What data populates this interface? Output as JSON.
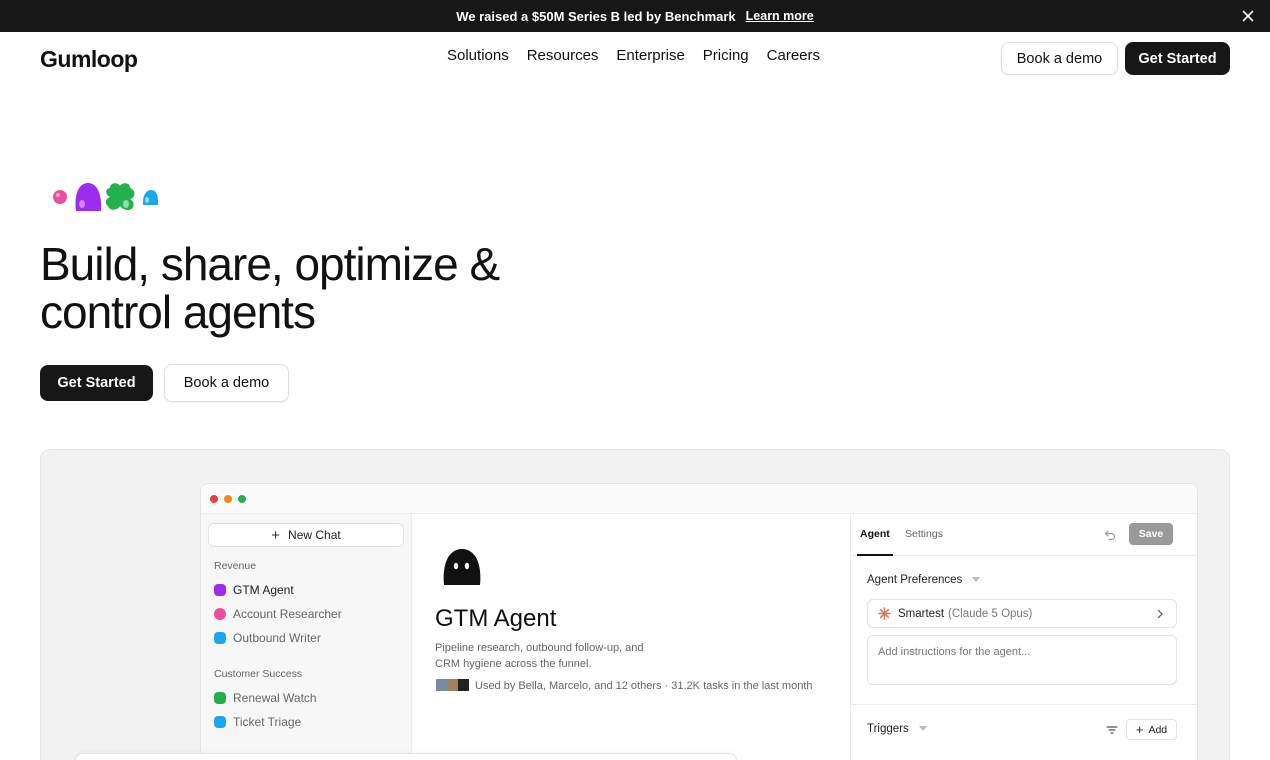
{
  "announcement": {
    "text": "We raised a $50M Series B led by Benchmark",
    "link": "Learn more"
  },
  "nav": {
    "logo": "Gumloop",
    "links": [
      "Solutions",
      "Resources",
      "Enterprise",
      "Pricing",
      "Careers"
    ],
    "book_demo": "Book a demo",
    "get_started": "Get Started"
  },
  "hero": {
    "title": "Build, share, optimize & control agents",
    "get_started": "Get Started",
    "book_demo": "Book a demo"
  },
  "app": {
    "sidebar": {
      "new_chat": "New Chat",
      "groups": [
        {
          "label": "Revenue",
          "items": [
            {
              "label": "GTM Agent",
              "icon": "purple-agent-icon",
              "color": "#9b2cf0"
            },
            {
              "label": "Account Researcher",
              "icon": "pink-agent-icon",
              "color": "#ee4d9c"
            },
            {
              "label": "Outbound Writer",
              "icon": "blue-agent-icon",
              "color": "#1ea7f0"
            }
          ]
        },
        {
          "label": "Customer Success",
          "items": [
            {
              "label": "Renewal Watch",
              "icon": "green-agent-icon",
              "color": "#22b14c"
            },
            {
              "label": "Ticket Triage",
              "icon": "blue-agent-icon",
              "color": "#1ea7f0"
            }
          ]
        }
      ]
    },
    "agent": {
      "title": "GTM Agent",
      "description": "Pipeline research, outbound follow-up, and CRM hygiene across the funnel.",
      "usage": "Used by Bella, Marcelo, and 12 others · 31.2K tasks in the last month"
    },
    "panel": {
      "tabs": [
        "Agent",
        "Settings"
      ],
      "save": "Save",
      "preferences_label": "Agent Preferences",
      "model_name": "Smartest",
      "model_detail": "(Claude 5 Opus)",
      "instructions_placeholder": "Add instructions for the agent...",
      "triggers_label": "Triggers",
      "add": "Add"
    }
  },
  "colors": {
    "dark": "#171717",
    "accent_purple": "#9b2cf0",
    "accent_pink": "#ee4d9c",
    "accent_green": "#22b14c",
    "accent_blue": "#1ea7f0"
  }
}
